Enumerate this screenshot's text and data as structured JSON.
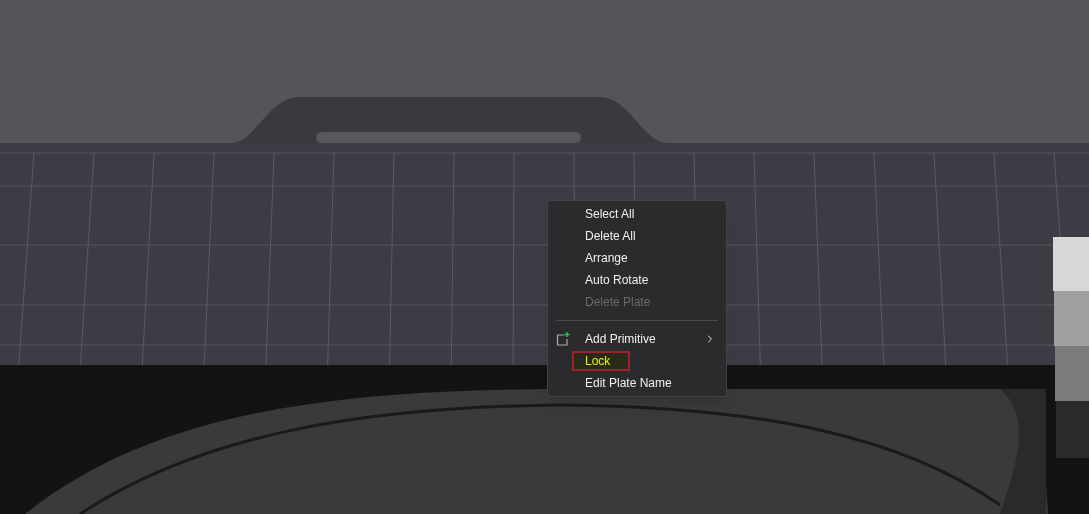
{
  "context_menu": {
    "items": [
      {
        "kind": "action",
        "label": "Select All",
        "disabled": false,
        "selected": false
      },
      {
        "kind": "action",
        "label": "Delete All",
        "disabled": false,
        "selected": false
      },
      {
        "kind": "action",
        "label": "Arrange",
        "disabled": false,
        "selected": false
      },
      {
        "kind": "action",
        "label": "Auto Rotate",
        "disabled": false,
        "selected": false
      },
      {
        "kind": "action",
        "label": "Delete Plate",
        "disabled": true,
        "selected": false
      },
      {
        "kind": "separator"
      },
      {
        "kind": "submenu",
        "label": "Add Primitive",
        "disabled": false,
        "selected": false
      },
      {
        "kind": "action",
        "label": "Lock",
        "disabled": false,
        "selected": true
      },
      {
        "kind": "action",
        "label": "Edit Plate Name",
        "disabled": false,
        "selected": false
      }
    ]
  }
}
